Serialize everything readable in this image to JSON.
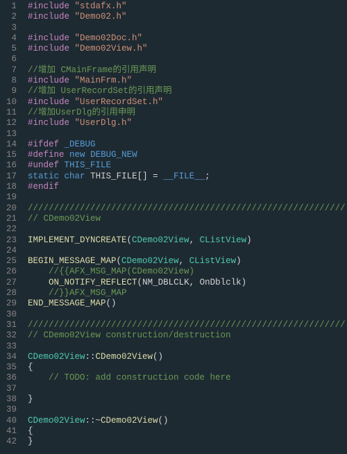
{
  "editor": {
    "lines": [
      {
        "n": 1,
        "tokens": [
          [
            "pre",
            "#include"
          ],
          [
            "",
            " "
          ],
          [
            "str",
            "\"stdafx.h\""
          ]
        ]
      },
      {
        "n": 2,
        "tokens": [
          [
            "pre",
            "#include"
          ],
          [
            "",
            " "
          ],
          [
            "str",
            "\"Demo02.h\""
          ]
        ]
      },
      {
        "n": 3,
        "tokens": []
      },
      {
        "n": 4,
        "tokens": [
          [
            "pre",
            "#include"
          ],
          [
            "",
            " "
          ],
          [
            "str",
            "\"Demo02Doc.h\""
          ]
        ]
      },
      {
        "n": 5,
        "tokens": [
          [
            "pre",
            "#include"
          ],
          [
            "",
            " "
          ],
          [
            "str",
            "\"Demo02View.h\""
          ]
        ]
      },
      {
        "n": 6,
        "tokens": []
      },
      {
        "n": 7,
        "tokens": [
          [
            "cmt",
            "//增加 CMainFrame的引用声明"
          ]
        ]
      },
      {
        "n": 8,
        "tokens": [
          [
            "pre",
            "#include"
          ],
          [
            "",
            " "
          ],
          [
            "str",
            "\"MainFrm.h\""
          ]
        ]
      },
      {
        "n": 9,
        "tokens": [
          [
            "cmt",
            "//增加 UserRecordSet的引用声明"
          ]
        ]
      },
      {
        "n": 10,
        "tokens": [
          [
            "pre",
            "#include"
          ],
          [
            "",
            " "
          ],
          [
            "str",
            "\"UserRecordSet.h\""
          ]
        ]
      },
      {
        "n": 11,
        "tokens": [
          [
            "cmt",
            "//增加UserDlg的引用申明"
          ]
        ]
      },
      {
        "n": 12,
        "tokens": [
          [
            "pre",
            "#include"
          ],
          [
            "",
            " "
          ],
          [
            "str",
            "\"UserDlg.h\""
          ]
        ]
      },
      {
        "n": 13,
        "tokens": []
      },
      {
        "n": 14,
        "tokens": [
          [
            "pre",
            "#ifdef"
          ],
          [
            "",
            " "
          ],
          [
            "macro",
            "_DEBUG"
          ]
        ]
      },
      {
        "n": 15,
        "tokens": [
          [
            "pre",
            "#define"
          ],
          [
            "",
            " "
          ],
          [
            "kw",
            "new"
          ],
          [
            "",
            " "
          ],
          [
            "macro",
            "DEBUG_NEW"
          ]
        ]
      },
      {
        "n": 16,
        "tokens": [
          [
            "pre",
            "#undef"
          ],
          [
            "",
            " "
          ],
          [
            "macro",
            "THIS_FILE"
          ]
        ]
      },
      {
        "n": 17,
        "tokens": [
          [
            "kw",
            "static"
          ],
          [
            "",
            " "
          ],
          [
            "kw",
            "char"
          ],
          [
            "",
            " "
          ],
          [
            "",
            "THIS_FILE[] = "
          ],
          [
            "macro",
            "__FILE__"
          ],
          [
            "",
            ";"
          ]
        ]
      },
      {
        "n": 18,
        "tokens": [
          [
            "pre",
            "#endif"
          ]
        ]
      },
      {
        "n": 19,
        "tokens": []
      },
      {
        "n": 20,
        "tokens": [
          [
            "cmt",
            "/////////////////////////////////////////////////////////////"
          ]
        ]
      },
      {
        "n": 21,
        "tokens": [
          [
            "cmt",
            "// CDemo02View"
          ]
        ]
      },
      {
        "n": 22,
        "tokens": []
      },
      {
        "n": 23,
        "tokens": [
          [
            "fn",
            "IMPLEMENT_DYNCREATE"
          ],
          [
            "",
            "("
          ],
          [
            "type",
            "CDemo02View"
          ],
          [
            "",
            ", "
          ],
          [
            "type",
            "CListView"
          ],
          [
            "",
            ")"
          ]
        ]
      },
      {
        "n": 24,
        "tokens": []
      },
      {
        "n": 25,
        "tokens": [
          [
            "fn",
            "BEGIN_MESSAGE_MAP"
          ],
          [
            "",
            "("
          ],
          [
            "type",
            "CDemo02View"
          ],
          [
            "",
            ", "
          ],
          [
            "type",
            "CListView"
          ],
          [
            "",
            ")"
          ]
        ]
      },
      {
        "n": 26,
        "tokens": [
          [
            "",
            "    "
          ],
          [
            "cmt",
            "//{{AFX_MSG_MAP(CDemo02View)"
          ]
        ]
      },
      {
        "n": 27,
        "tokens": [
          [
            "",
            "    "
          ],
          [
            "fn",
            "ON_NOTIFY_REFLECT"
          ],
          [
            "",
            "("
          ],
          [
            "",
            "NM_DBLCLK"
          ],
          [
            "",
            ", "
          ],
          [
            "",
            "OnDblclk"
          ],
          [
            "",
            ")"
          ]
        ]
      },
      {
        "n": 28,
        "tokens": [
          [
            "",
            "    "
          ],
          [
            "cmt",
            "//}}AFX_MSG_MAP"
          ]
        ]
      },
      {
        "n": 29,
        "tokens": [
          [
            "fn",
            "END_MESSAGE_MAP"
          ],
          [
            "",
            "()"
          ]
        ]
      },
      {
        "n": 30,
        "tokens": []
      },
      {
        "n": 31,
        "tokens": [
          [
            "cmt",
            "/////////////////////////////////////////////////////////////"
          ]
        ]
      },
      {
        "n": 32,
        "tokens": [
          [
            "cmt",
            "// CDemo02View construction/destruction"
          ]
        ]
      },
      {
        "n": 33,
        "tokens": []
      },
      {
        "n": 34,
        "tokens": [
          [
            "type",
            "CDemo02View"
          ],
          [
            "",
            "::"
          ],
          [
            "fn",
            "CDemo02View"
          ],
          [
            "",
            "()"
          ]
        ]
      },
      {
        "n": 35,
        "tokens": [
          [
            "",
            "{"
          ]
        ]
      },
      {
        "n": 36,
        "tokens": [
          [
            "",
            "    "
          ],
          [
            "cmt",
            "// TODO: add construction code here"
          ]
        ]
      },
      {
        "n": 37,
        "tokens": []
      },
      {
        "n": 38,
        "tokens": [
          [
            "",
            "}"
          ]
        ]
      },
      {
        "n": 39,
        "tokens": []
      },
      {
        "n": 40,
        "tokens": [
          [
            "type",
            "CDemo02View"
          ],
          [
            "",
            "::~"
          ],
          [
            "fn",
            "CDemo02View"
          ],
          [
            "",
            "()"
          ]
        ]
      },
      {
        "n": 41,
        "tokens": [
          [
            "",
            "{"
          ]
        ]
      },
      {
        "n": 42,
        "tokens": [
          [
            "",
            "}"
          ]
        ]
      }
    ]
  }
}
